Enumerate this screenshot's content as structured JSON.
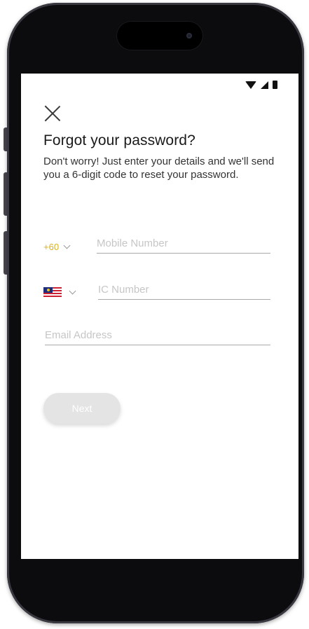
{
  "status_bar": {
    "wifi_icon": "wifi-icon",
    "signal_icon": "signal-icon",
    "battery_icon": "battery-icon"
  },
  "header": {
    "close_icon": "close-icon",
    "title": "Forgot your password?",
    "subtitle": "Don't worry! Just enter your details and we'll send you a 6-digit code to reset your password."
  },
  "form": {
    "country_code": {
      "value": "+60",
      "color": "#d9b21f"
    },
    "mobile": {
      "placeholder": "Mobile Number",
      "value": ""
    },
    "id_type": {
      "flag_icon": "malaysia-flag-icon"
    },
    "ic": {
      "placeholder": "IC Number",
      "value": ""
    },
    "email": {
      "placeholder": "Email Address",
      "value": ""
    },
    "next_label": "Next"
  },
  "colors": {
    "accent": "#d9b21f",
    "button_disabled_bg": "#e4e4e4",
    "phone_frame": "#0c0c0e"
  }
}
